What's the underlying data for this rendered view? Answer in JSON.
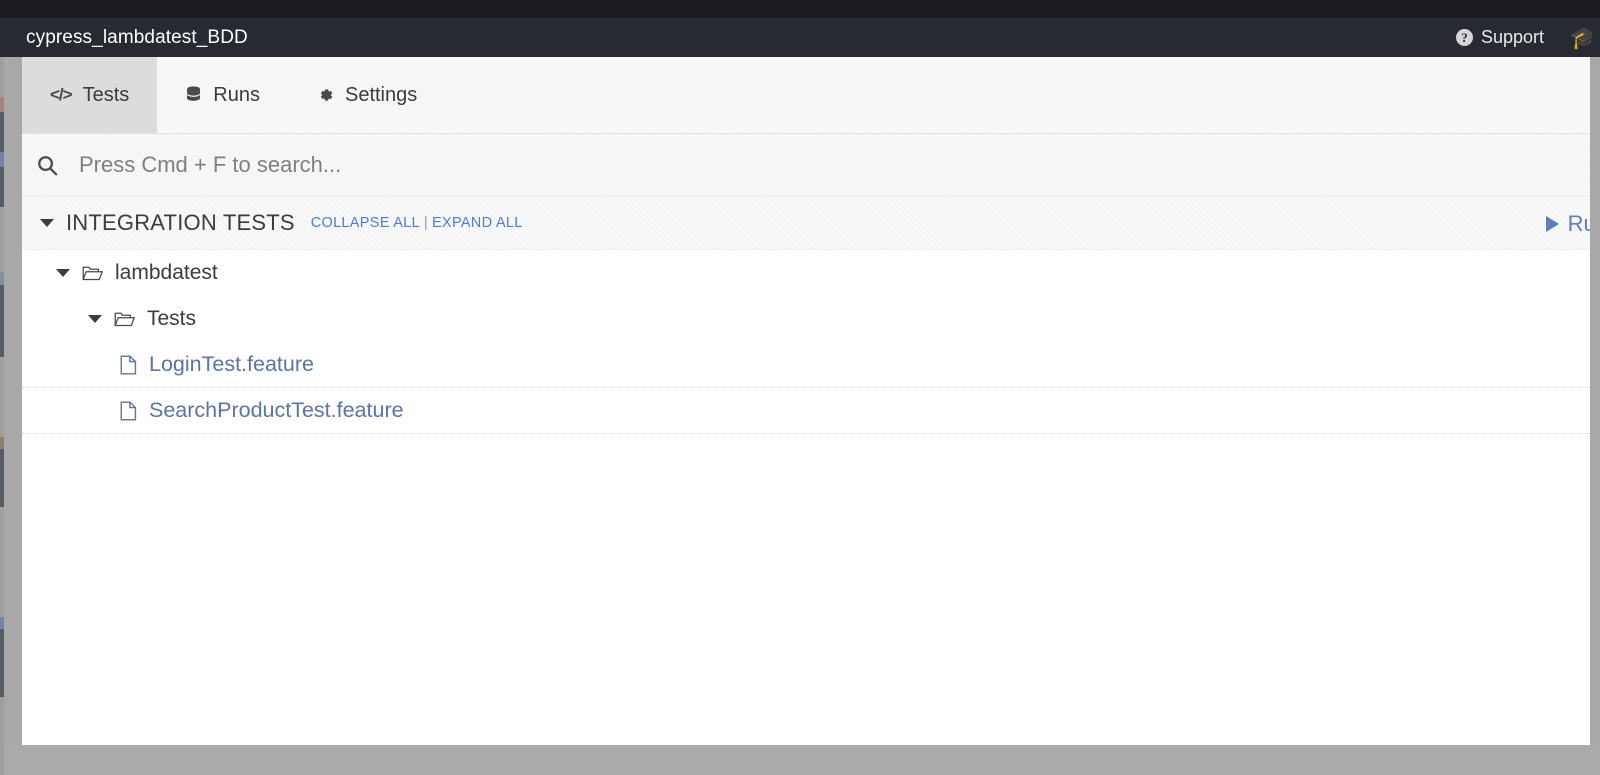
{
  "window": {
    "project_title": "cypress_lambdatest_BDD"
  },
  "header": {
    "support_label": "Support",
    "support_icon": "question-circle-icon",
    "docs_icon": "graduation-cap-icon"
  },
  "tabs": [
    {
      "label": "Tests",
      "icon": "code-brackets-icon",
      "active": true
    },
    {
      "label": "Runs",
      "icon": "database-icon",
      "active": false
    },
    {
      "label": "Settings",
      "icon": "gear-icon",
      "active": false
    }
  ],
  "search": {
    "icon": "search-icon",
    "placeholder": "Press Cmd + F to search...",
    "value": ""
  },
  "spec_header": {
    "title": "INTEGRATION TESTS",
    "collapse_all": "COLLAPSE ALL",
    "separator": "|",
    "expand_all": "EXPAND ALL",
    "run_all_label": "Run",
    "run_all_icon": "play-icon",
    "caret_icon": "caret-down-icon"
  },
  "tree": [
    {
      "type": "folder",
      "label": "lambdatest",
      "depth": 0,
      "expanded": true,
      "icon": "folder-open-icon"
    },
    {
      "type": "folder",
      "label": "Tests",
      "depth": 1,
      "expanded": true,
      "icon": "folder-open-icon"
    },
    {
      "type": "file",
      "label": "LoginTest.feature",
      "depth": 2,
      "icon": "file-icon"
    },
    {
      "type": "file",
      "label": "SearchProductTest.feature",
      "depth": 2,
      "icon": "file-icon"
    }
  ],
  "colors": {
    "header_dark": "#272a31",
    "titlebar_dark": "#1b1c20",
    "active_tab": "#dcdcdc",
    "link_blue": "#4a7fd0",
    "file_blue": "#5c73a8",
    "run_blue": "#5c7dbe",
    "window_border": "#a8a8a8"
  }
}
